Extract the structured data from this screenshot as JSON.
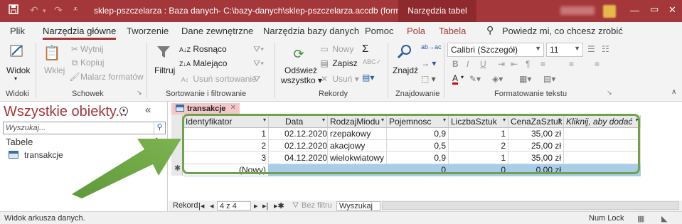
{
  "titlebar": {
    "title": "sklep-pszczelarza : Baza danych- C:\\bazy-danych\\sklep-pszczelarza.accdb (format pliku p...",
    "context_label": "Narzędzia tabel",
    "save_icon": "save-icon",
    "undo_icon": "undo-icon",
    "redo_icon": "redo-icon",
    "color": "#a4373a"
  },
  "menu": {
    "tabs": [
      "Plik",
      "Narzędzia główne",
      "Tworzenie",
      "Dane zewnętrzne",
      "Narzędzia bazy danych",
      "Pomoc",
      "Pola",
      "Tabela"
    ],
    "tell_me": "Powiedz mi, co chcesz zrobić"
  },
  "ribbon": {
    "widoki": {
      "view_label": "Widok",
      "group": "Widoki"
    },
    "schowek": {
      "paste": "Wklej",
      "cut": "Wytnij",
      "copy": "Kopiuj",
      "painter": "Malarz formatów",
      "group": "Schowek"
    },
    "sort": {
      "filter": "Filtruj",
      "asc": "Rosnąco",
      "desc": "Malejąco",
      "remove": "Usuń sortowanie",
      "group": "Sortowanie i filtrowanie"
    },
    "rekordy": {
      "refresh_1": "Odśwież",
      "refresh_2": "wszystko",
      "new": "Nowy",
      "save": "Zapisz",
      "delete": "Usuń",
      "group": "Rekordy"
    },
    "znajdowanie": {
      "find": "Znajdź",
      "group": "Znajdowanie"
    },
    "format": {
      "font": "Calibri (Szczegół)",
      "size": "11",
      "bold": "B",
      "italic": "I",
      "underline": "U",
      "font_color": "A",
      "group": "Formatowanie tekstu"
    }
  },
  "nav": {
    "title": "Wszystkie obiekty...",
    "search_placeholder": "Wyszukaj...",
    "group": "Tabele",
    "item": "transakcje"
  },
  "document": {
    "tab_label": "transakcje",
    "columns": [
      "Identyfikator",
      "Data",
      "RodzajMiodu",
      "Pojemnosc",
      "LiczbaSztuk",
      "CenaZaSztuk",
      "Kliknij, aby dodać"
    ],
    "rows": [
      [
        "1",
        "02.12.2020",
        "rzepakowy",
        "0,9",
        "1",
        "35,00 zł"
      ],
      [
        "2",
        "02.12.2020",
        "akacjowy",
        "0,5",
        "2",
        "25,00 zł"
      ],
      [
        "3",
        "04.12.2020",
        "wielokwiatowy",
        "0,9",
        "1",
        "35,00 zł"
      ]
    ],
    "new_row": [
      "(Nowy)",
      "",
      "",
      "0",
      "0",
      "0,00 zł"
    ]
  },
  "recnav": {
    "label": "Rekord:",
    "position": "4 z 4",
    "filter": "Bez filtru",
    "search": "Wyszukaj"
  },
  "status": {
    "text": "Widok arkusza danych.",
    "numlock": "Num Lock"
  }
}
